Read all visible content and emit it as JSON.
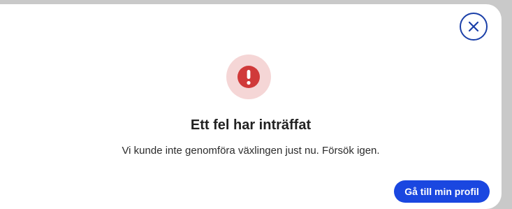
{
  "dialog": {
    "title": "Ett fel har inträffat",
    "message": "Vi kunde inte genomföra växlingen just nu. Försök igen.",
    "primary_button_label": "Gå till min profil",
    "close_icon": "close-icon",
    "alert_icon": "exclamation-icon"
  },
  "colors": {
    "accent": "#1a47e0",
    "close_border": "#1a3fa8",
    "error": "#d03a3a",
    "error_bg": "#f5d6d6"
  }
}
